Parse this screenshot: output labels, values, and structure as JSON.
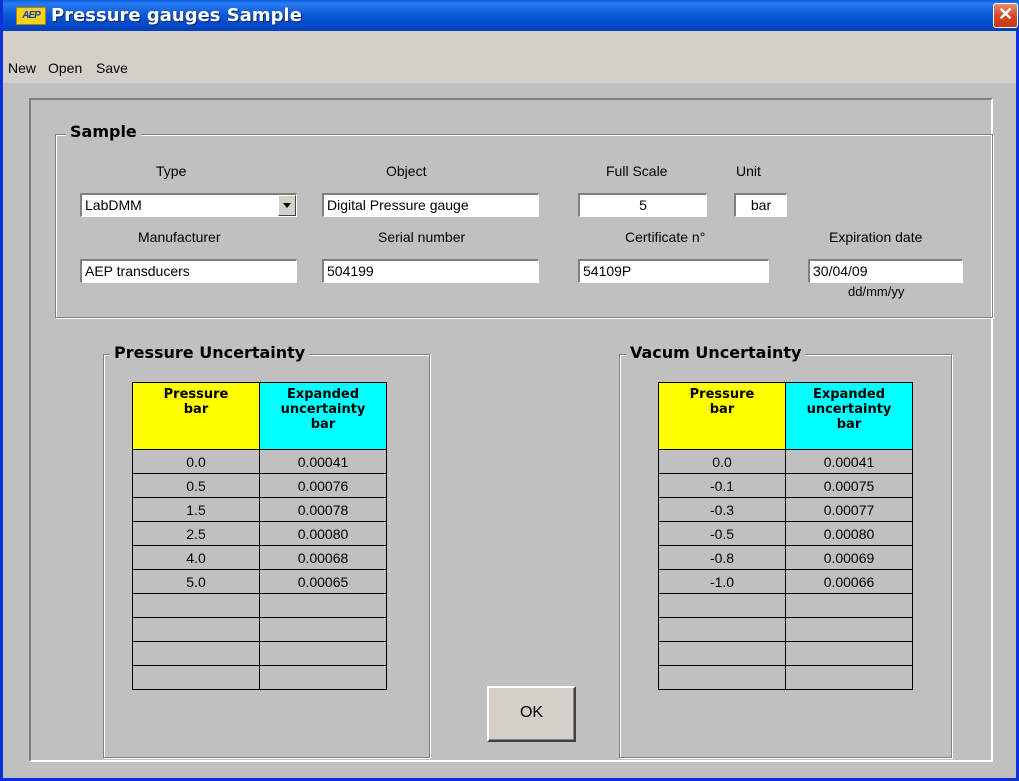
{
  "window": {
    "title": "Pressure gauges Sample",
    "logo_text": "AEP",
    "close_glyph": "✕"
  },
  "menu": {
    "new": "New",
    "open": "Open",
    "save": "Save"
  },
  "sample": {
    "legend": "Sample",
    "type_label": "Type",
    "type_value": "LabDMM",
    "object_label": "Object",
    "object_value": "Digital Pressure gauge",
    "full_scale_label": "Full Scale",
    "full_scale_value": "5",
    "unit_label": "Unit",
    "unit_value": "bar",
    "manufacturer_label": "Manufacturer",
    "manufacturer_value": "AEP transducers",
    "serial_label": "Serial number",
    "serial_value": "504199",
    "certificate_label": "Certificate n°",
    "certificate_value": "54109P",
    "expiration_label": "Expiration date",
    "expiration_value": "30/04/09",
    "date_format": "dd/mm/yy"
  },
  "pressure": {
    "legend": "Pressure Uncertainty",
    "col1": [
      "Pressure",
      "bar"
    ],
    "col2": [
      "Expanded",
      "uncertainty",
      "bar"
    ],
    "rows": [
      [
        "0.0",
        "0.00041"
      ],
      [
        "0.5",
        "0.00076"
      ],
      [
        "1.5",
        "0.00078"
      ],
      [
        "2.5",
        "0.00080"
      ],
      [
        "4.0",
        "0.00068"
      ],
      [
        "5.0",
        "0.00065"
      ],
      [
        "",
        ""
      ],
      [
        "",
        ""
      ],
      [
        "",
        ""
      ],
      [
        "",
        ""
      ]
    ]
  },
  "vacuum": {
    "legend": "Vacum Uncertainty",
    "col1": [
      "Pressure",
      "bar"
    ],
    "col2": [
      "Expanded",
      "uncertainty",
      "bar"
    ],
    "rows": [
      [
        "0.0",
        "0.00041"
      ],
      [
        "-0.1",
        "0.00075"
      ],
      [
        "-0.3",
        "0.00077"
      ],
      [
        "-0.5",
        "0.00080"
      ],
      [
        "-0.8",
        "0.00069"
      ],
      [
        "-1.0",
        "0.00066"
      ],
      [
        "",
        ""
      ],
      [
        "",
        ""
      ],
      [
        "",
        ""
      ],
      [
        "",
        ""
      ]
    ]
  },
  "ok_label": "OK",
  "colors": {
    "header_yellow": "#ffff00",
    "header_cyan": "#00ffff",
    "titlebar": "#0a5fe0"
  }
}
